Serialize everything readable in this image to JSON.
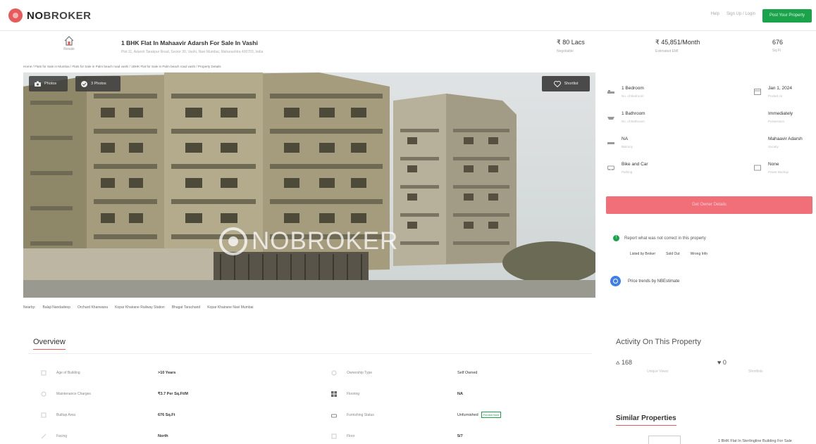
{
  "brand": {
    "logo_text_no": "NO",
    "logo_text_broker": "BROKER"
  },
  "topbar": {
    "links": [
      "Help",
      "Sign Up / Login"
    ],
    "post_property": "Post Your Property"
  },
  "header": {
    "icon_label": "Resale",
    "title": "1 BHK Flat In Mahaavir Adarsh For Sale In Vashi",
    "address": "Plot 11, Adarsh Tarakpur Road, Sector 30, Vashi, Navi Mumbai, Maharashtra 400703, India",
    "price": "₹ 80 Lacs",
    "price_sub": "Negotiable",
    "emi": "₹ 45,851/Month",
    "emi_sub": "Estimated EMI",
    "area": "676",
    "area_sub": "Sq.Ft"
  },
  "breadcrumb": "Home / Flats for Sale in Mumbai / Flats for Sale in Palm beach road vashi / 1BHK Flat for Sale in Palm beach road vashi / Property Details",
  "gallery": {
    "photos_label": "Photos",
    "videos_label": "3 Photos",
    "shortlist_label": "Shortlist",
    "watermark": "NOBROKER"
  },
  "nearby": [
    "Nearby:",
    "Balaji Nandadeep",
    "Orchard Khanwana",
    "Kopar Khairane Railway Station",
    "Bhagat Tarachand",
    "Kopar Khairane Navi Mumbai"
  ],
  "features": [
    {
      "title": "1 Bedroom",
      "sub": "No. of Bedroom"
    },
    {
      "title": "Jan 1, 2024",
      "sub": "Posted on"
    },
    {
      "title": "1 Bathroom",
      "sub": "No. of Bathroom"
    },
    {
      "title": "Immediately",
      "sub": "Possession"
    },
    {
      "title": "NA",
      "sub": "Balcony"
    },
    {
      "title": "Mahaavir Adarsh",
      "sub": "Society"
    },
    {
      "title": "Bike and Car",
      "sub": "Parking"
    },
    {
      "title": "None",
      "sub": "Power Backup"
    }
  ],
  "contact_button": "Get Owner Details",
  "report": {
    "text": "Report what was not correct in this property",
    "links": [
      "Listed by Broker",
      "Sold Out",
      "Wrong Info"
    ]
  },
  "price_trend": "Price trends by NBEstimate",
  "activity": {
    "title": "Activity On This Property",
    "views": "168",
    "views_sub": "Unique Views",
    "shortlists": "0",
    "shortlists_sub": "Shortlists"
  },
  "similar": {
    "title": "Similar Properties",
    "item": "1 BHK Flat In Sterlingline Building For Sale"
  },
  "overview": {
    "tab": "Overview",
    "rows_left": [
      {
        "label": "Age of Building",
        "value": ">10 Years"
      },
      {
        "label": "Maintenance Charges",
        "value": "₹3.7 Per Sq.Ft/M"
      },
      {
        "label": "Builtup Area",
        "value": "676 Sq.Ft"
      },
      {
        "label": "Facing",
        "value": "North"
      }
    ],
    "rows_right": [
      {
        "label": "Ownership Type",
        "value": "Self Owned"
      },
      {
        "label": "Flooring",
        "value": "NA"
      },
      {
        "label": "Furnishing Status",
        "value": "Unfurnished"
      },
      {
        "label": "Floor",
        "value": "5/7"
      }
    ],
    "furnishing_badge": "Furnish Now"
  },
  "colors": {
    "brand_red": "#e65a5a",
    "green": "#1aa34a",
    "contact_pink": "#f06f78"
  }
}
